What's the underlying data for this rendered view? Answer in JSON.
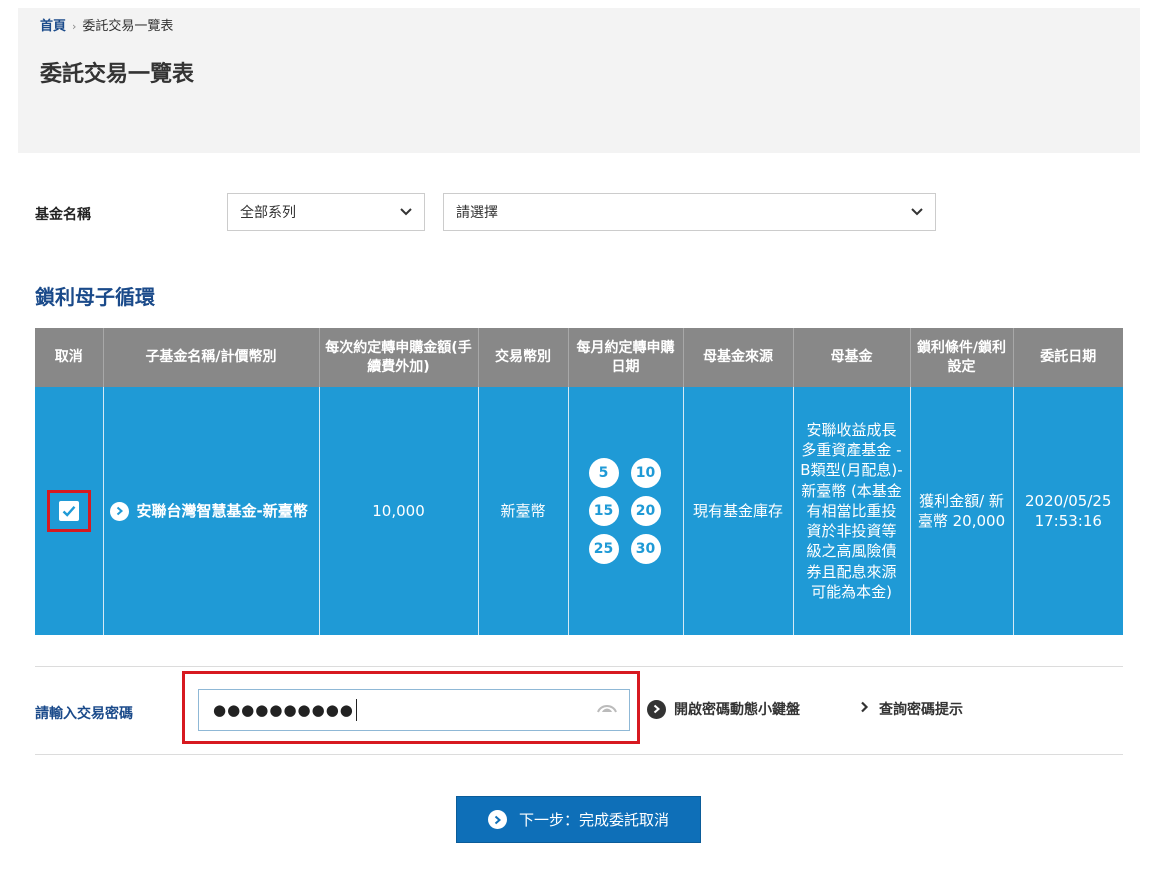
{
  "breadcrumb": {
    "home": "首頁",
    "current": "委託交易一覽表"
  },
  "page_title": "委託交易一覽表",
  "filter": {
    "label": "基金名稱",
    "series_select": "全部系列",
    "fund_select": "請選擇"
  },
  "section_title": "鎖利母子循環",
  "table": {
    "headers": [
      "取消",
      "子基金名稱/計價幣別",
      "每次約定轉申購金額(手續費外加)",
      "交易幣別",
      "每月約定轉申購日期",
      "母基金來源",
      "母基金",
      "鎖利條件/鎖利設定",
      "委託日期"
    ],
    "rows": [
      {
        "checked": true,
        "child_fund": "安聯台灣智慧基金-新臺幣",
        "amount": "10,000",
        "currency": "新臺幣",
        "days": [
          "5",
          "10",
          "15",
          "20",
          "25",
          "30"
        ],
        "mother_source": "現有基金庫存",
        "mother_fund": "安聯收益成長多重資產基金 - B類型(月配息)-新臺幣 (本基金有相當比重投資於非投資等級之高風險債券且配息來源可能為本金)",
        "lock_condition": "獲利金額/ 新臺幣 20,000",
        "date": "2020/05/25 17:53:16"
      }
    ]
  },
  "password": {
    "label": "請輸入交易密碼",
    "masked_value": "●●●●●●●●●●",
    "keyboard_link": "開啟密碼動態小鍵盤",
    "hint_link": "查詢密碼提示"
  },
  "next_button": "下一步：完成委託取消",
  "colors": {
    "accent": "#1f9ad6",
    "header_gray": "#888888",
    "highlight_red": "#d71920",
    "button_blue": "#0e6fb8",
    "title_blue": "#1a4a8a"
  },
  "icons": {
    "checkbox": "check-icon",
    "fund_bullet": "chevron-right-circle-icon",
    "eye": "eye-icon",
    "keyboard_bullet": "chevron-right-circle-icon",
    "hint_bullet": "chevron-right-icon"
  }
}
